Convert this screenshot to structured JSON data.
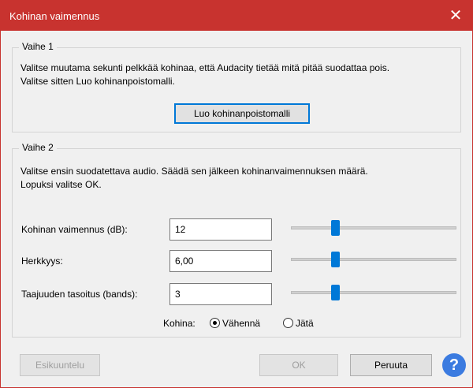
{
  "window": {
    "title": "Kohinan vaimennus",
    "close_symbol": "✕"
  },
  "step1": {
    "legend": "Vaihe 1",
    "line1": "Valitse muutama sekunti pelkkää kohinaa, että Audacity tietää mitä pitää suodattaa pois.",
    "line2": "Valitse sitten Luo kohinanpoistomalli.",
    "button": "Luo kohinanpoistomalli"
  },
  "step2": {
    "legend": "Vaihe 2",
    "line1": "Valitse ensin suodatettava audio. Säädä sen jälkeen kohinanvaimennuksen määrä.",
    "line2": "Lopuksi valitse OK.",
    "fields": [
      {
        "label": "Kohinan vaimennus (dB):",
        "value": "12",
        "slider_fraction": 0.27
      },
      {
        "label": "Herkkyys:",
        "value": "6,00",
        "slider_fraction": 0.27
      },
      {
        "label": "Taajuuden tasoitus (bands):",
        "value": "3",
        "slider_fraction": 0.27
      }
    ],
    "noise_label": "Kohina:",
    "options": [
      {
        "label": "Vähennä",
        "selected": true
      },
      {
        "label": "Jätä",
        "selected": false
      }
    ]
  },
  "footer": {
    "preview": "Esikuuntelu",
    "ok": "OK",
    "cancel": "Peruuta",
    "help": "?"
  }
}
